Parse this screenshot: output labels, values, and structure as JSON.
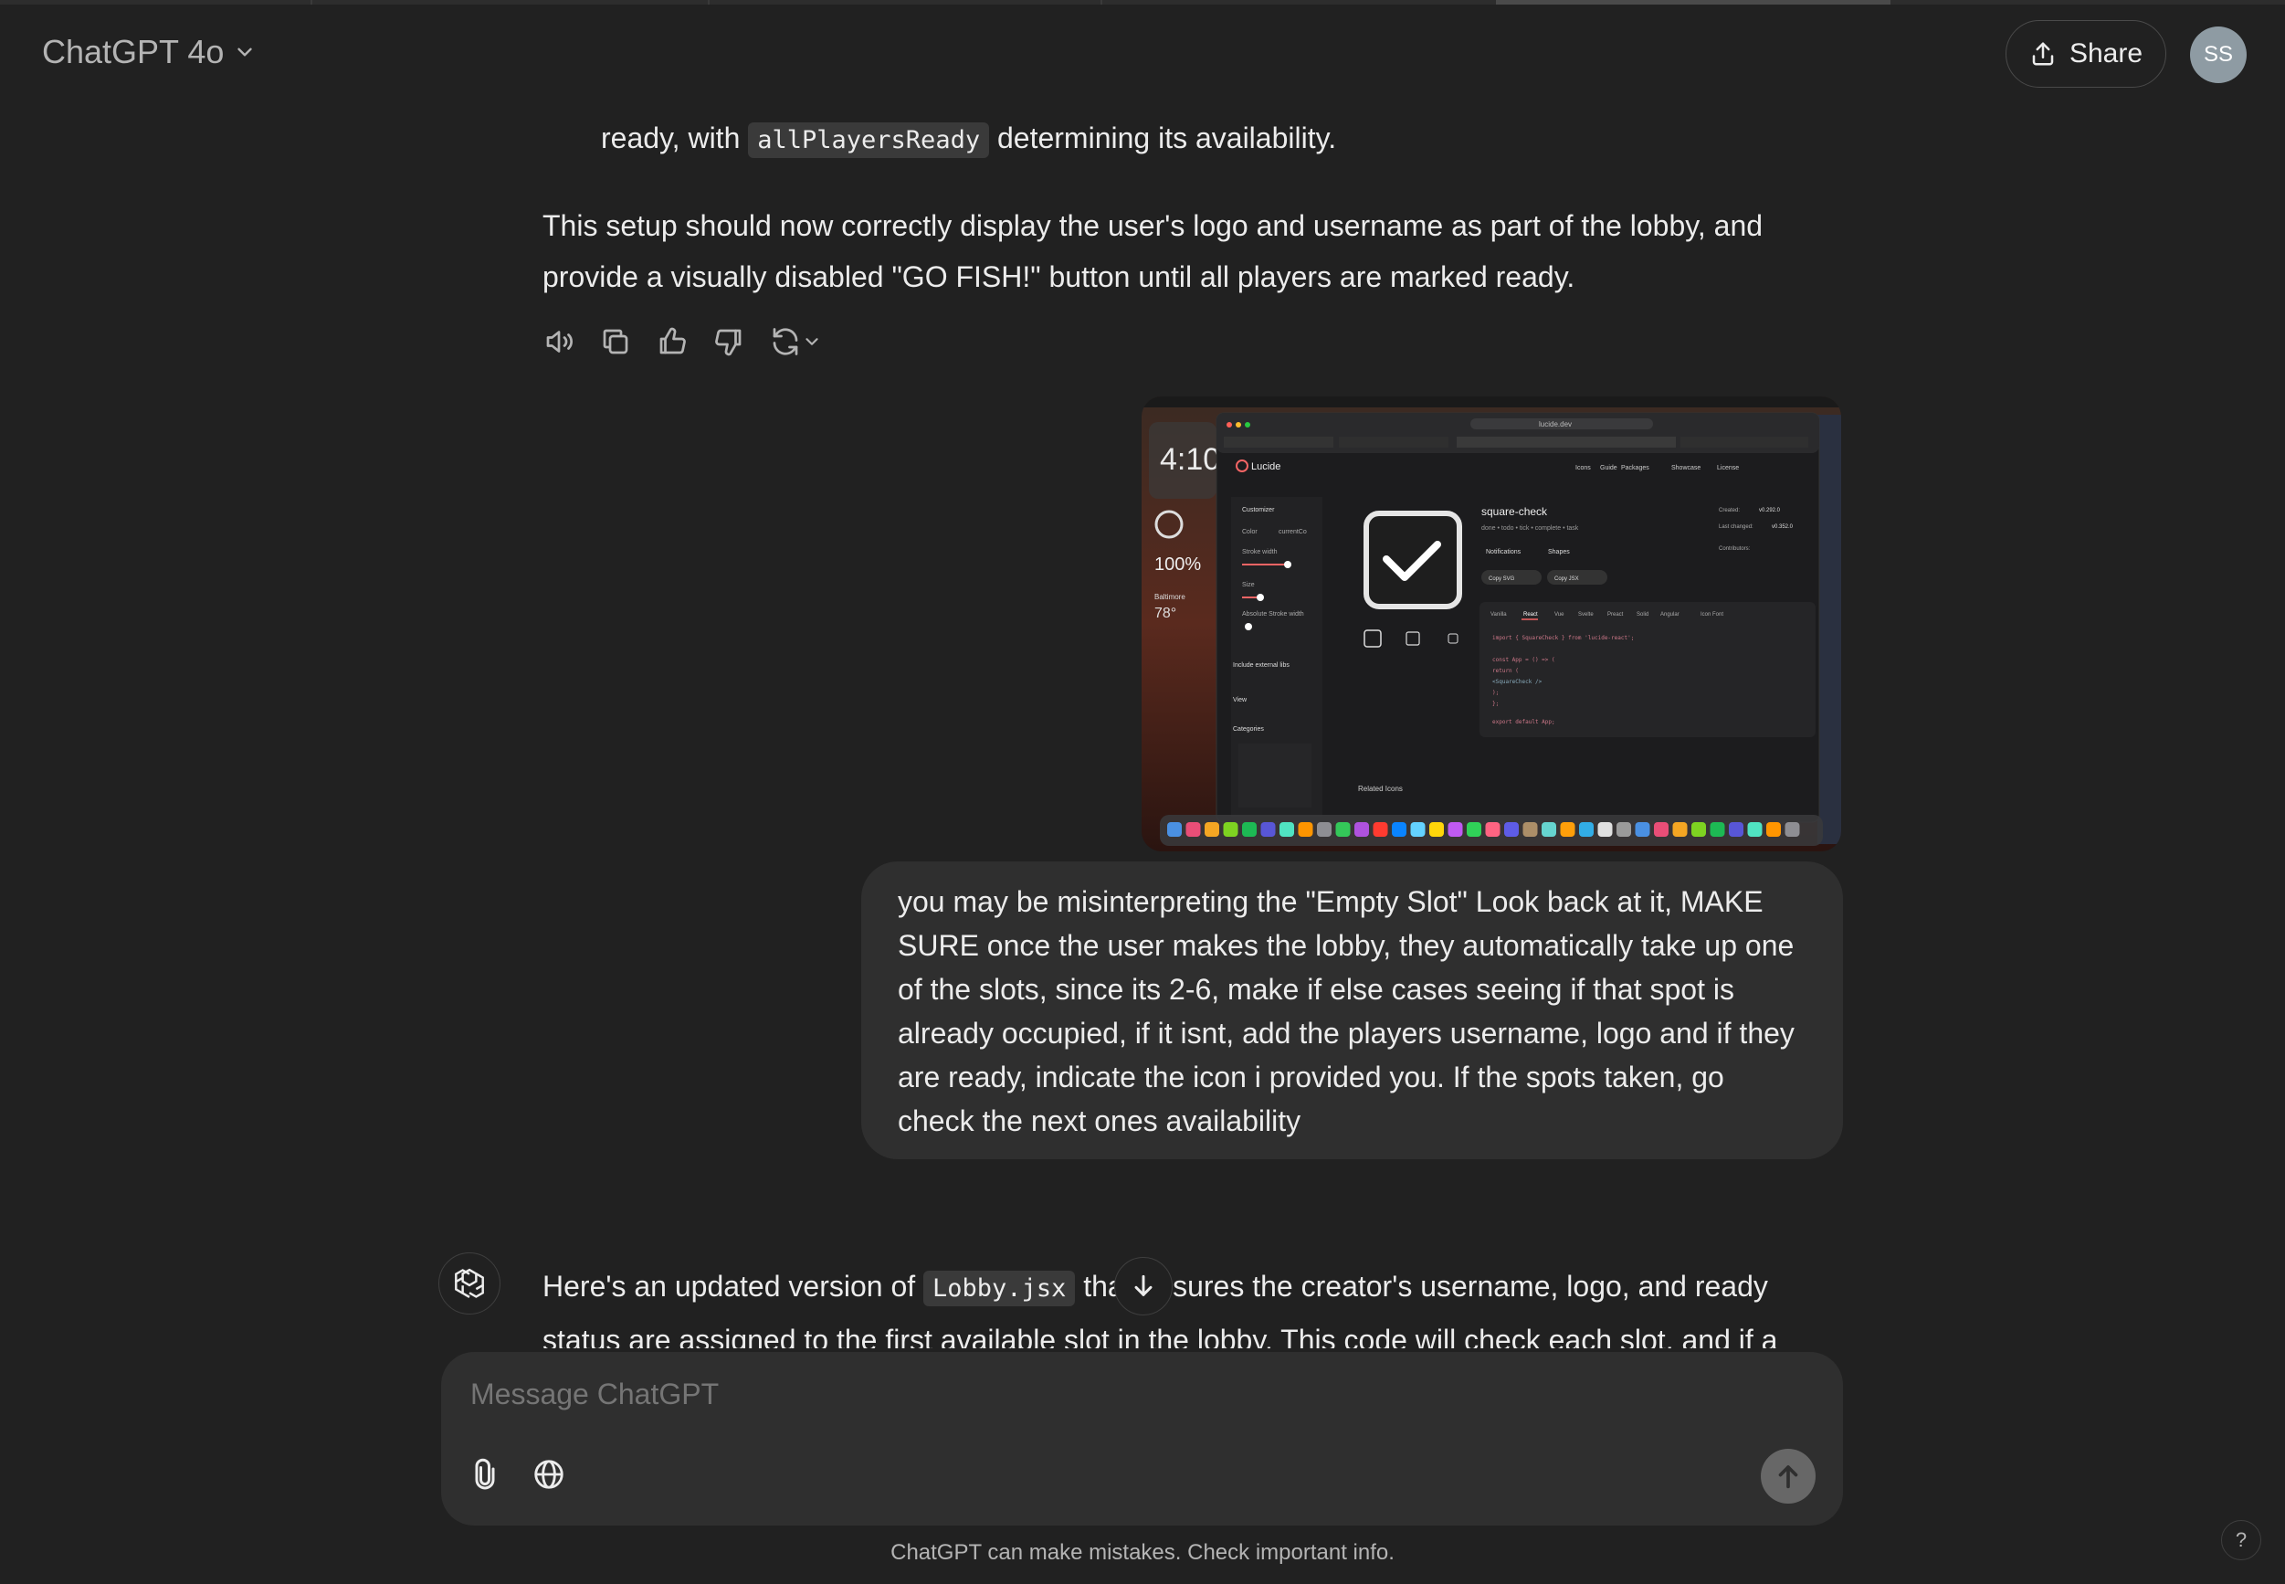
{
  "header": {
    "model_name": "ChatGPT 4o",
    "share_label": "Share",
    "avatar_initials": "SS"
  },
  "assistant_prev": {
    "line1_pre": "ready, with",
    "line1_code": "allPlayersReady",
    "line1_post": "determining its availability.",
    "para_line1": "This setup should now correctly display the user's logo and username as part of the lobby, and",
    "para_line2": "provide a visually disabled \"GO FISH!\" button until all players are marked ready."
  },
  "user_message": {
    "text": "you may be misinterpreting the \"Empty Slot\" Look back at it, MAKE SURE once the user makes the lobby, they automatically take up one of the slots, since its 2-6, make if else cases seeing if that spot is already occupied, if it isnt, add the players username, logo and if they are ready, indicate the icon i provided you. If the spots taken, go check the next ones availability"
  },
  "screenshot": {
    "clock": "4:10",
    "battery": "100%",
    "weather_city": "Baltimore",
    "weather_temp": "78°",
    "app_name": "Lucide",
    "url": "lucide.dev",
    "icon_name": "square-check",
    "icon_tags": "done • todo • tick • complete • task",
    "created_label": "Created:",
    "created_version": "v0.292.0",
    "changed_label": "Last changed:",
    "changed_version": "v0.352.0",
    "contributors_label": "Contributors:",
    "customizer_label": "Customizer",
    "color_label": "Color",
    "color_value": "currentCo",
    "stroke_label": "Stroke width",
    "size_label": "Size",
    "abs_stroke_label": "Absolute Stroke width",
    "include_label": "Include external libs",
    "view_label": "View",
    "categories_label": "Categories",
    "related_label": "Related Icons",
    "copy_svg": "Copy SVG",
    "copy_jsx": "Copy JSX",
    "notif_tab": "Notifications",
    "shapes_tab": "Shapes",
    "nav_items": [
      "Icons",
      "Guide",
      "Packages",
      "Showcase",
      "License"
    ],
    "code_tabs": [
      "Vanilla",
      "React",
      "Vue",
      "Svelte",
      "Preact",
      "Solid",
      "Angular",
      "Icon Font"
    ],
    "code_lines": [
      "import { SquareCheck } from 'lucide-react';",
      "const App = () => (",
      "  return (",
      "    <SquareCheck />",
      "  );",
      "};",
      "export default App;"
    ]
  },
  "assistant_current": {
    "line1_pre": "Here's an updated version of",
    "line1_code": "Lobby.jsx",
    "line1_post": "that ensures the creator's username, logo, and ready",
    "line2": "status are assigned to the first available slot in the lobby. This code will check each slot, and if a"
  },
  "composer": {
    "placeholder": "Message ChatGPT"
  },
  "footer": {
    "note": "ChatGPT can make mistakes. Check important info.",
    "help": "?"
  }
}
